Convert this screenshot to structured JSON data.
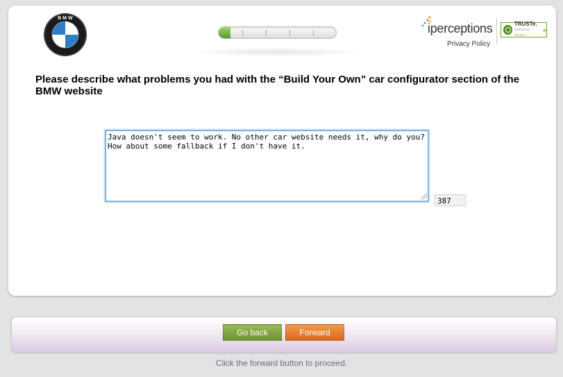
{
  "header": {
    "logo_name": "BMW",
    "progress_fraction": 0.1,
    "progress_segments": 5,
    "brand_name": "iperceptions",
    "privacy_policy_label": "Privacy Policy",
    "truste_label": "TRUSTe.",
    "truste_sublabel": "CERTIFIED PRIVACY"
  },
  "question": {
    "text": "Please describe what problems you had with the “Build Your Own” car configurator section of the BMW website"
  },
  "answer": {
    "value": "Java doesn't seem to work. No other car website needs it, why do you? How about some fallback if I don't have it.",
    "chars_remaining": "387"
  },
  "nav": {
    "back_label": "Go back",
    "forward_label": "Forward",
    "hint": "Click the forward button to proceed."
  },
  "colors": {
    "accent_green": "#6e9133",
    "accent_orange": "#d9681e",
    "hint_text": "#6f6888",
    "focus_border": "#7ab4e6"
  }
}
